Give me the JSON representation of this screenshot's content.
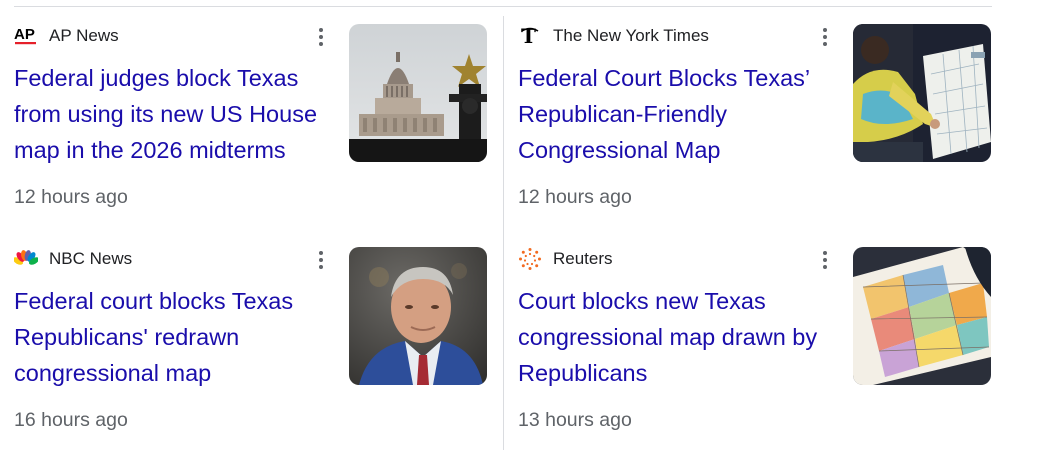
{
  "articles": [
    {
      "source": "AP News",
      "source_icon": "ap-news-logo-icon",
      "headline": "Federal judges block Texas from using its new US House map in the 2026 midterms",
      "time": "12 hours ago",
      "thumbnail": "texas-capitol-dome-image"
    },
    {
      "source": "The New York Times",
      "source_icon": "nyt-logo-icon",
      "headline": "Federal Court Blocks Texas’ Republican-Friendly Congressional Map",
      "time": "12 hours ago",
      "thumbnail": "person-pointing-at-map-image"
    },
    {
      "source": "NBC News",
      "source_icon": "nbc-peacock-logo-icon",
      "headline": "Federal court blocks Texas Republicans' redrawn congressional map",
      "time": "16 hours ago",
      "thumbnail": "man-in-blue-suit-portrait-image"
    },
    {
      "source": "Reuters",
      "source_icon": "reuters-logo-icon",
      "headline": "Court blocks new Texas congressional map drawn by Republicans",
      "time": "13 hours ago",
      "thumbnail": "congressional-district-map-image"
    }
  ],
  "colors": {
    "headline": "#1a0dab",
    "source_text": "#202124",
    "time_text": "#5f6368",
    "divider": "#dadce0",
    "ap_red": "#e5202a"
  }
}
